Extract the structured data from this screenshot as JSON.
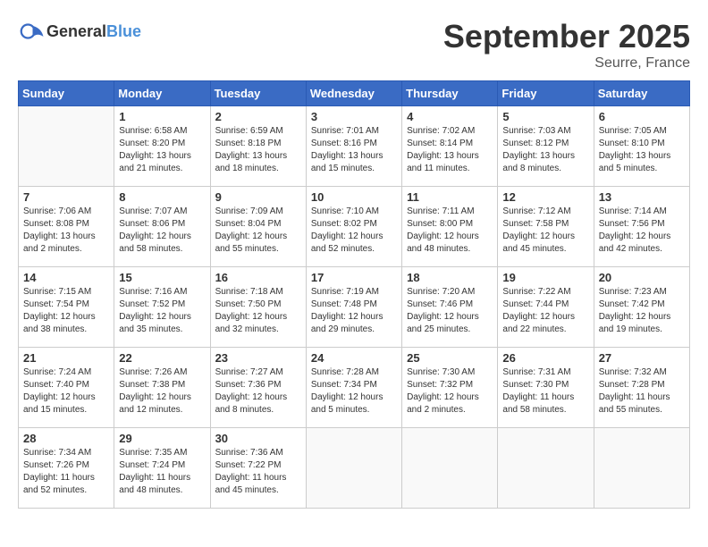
{
  "logo": {
    "general": "General",
    "blue": "Blue"
  },
  "title": "September 2025",
  "location": "Seurre, France",
  "weekdays": [
    "Sunday",
    "Monday",
    "Tuesday",
    "Wednesday",
    "Thursday",
    "Friday",
    "Saturday"
  ],
  "weeks": [
    [
      {
        "day": "",
        "info": ""
      },
      {
        "day": "1",
        "info": "Sunrise: 6:58 AM\nSunset: 8:20 PM\nDaylight: 13 hours\nand 21 minutes."
      },
      {
        "day": "2",
        "info": "Sunrise: 6:59 AM\nSunset: 8:18 PM\nDaylight: 13 hours\nand 18 minutes."
      },
      {
        "day": "3",
        "info": "Sunrise: 7:01 AM\nSunset: 8:16 PM\nDaylight: 13 hours\nand 15 minutes."
      },
      {
        "day": "4",
        "info": "Sunrise: 7:02 AM\nSunset: 8:14 PM\nDaylight: 13 hours\nand 11 minutes."
      },
      {
        "day": "5",
        "info": "Sunrise: 7:03 AM\nSunset: 8:12 PM\nDaylight: 13 hours\nand 8 minutes."
      },
      {
        "day": "6",
        "info": "Sunrise: 7:05 AM\nSunset: 8:10 PM\nDaylight: 13 hours\nand 5 minutes."
      }
    ],
    [
      {
        "day": "7",
        "info": "Sunrise: 7:06 AM\nSunset: 8:08 PM\nDaylight: 13 hours\nand 2 minutes."
      },
      {
        "day": "8",
        "info": "Sunrise: 7:07 AM\nSunset: 8:06 PM\nDaylight: 12 hours\nand 58 minutes."
      },
      {
        "day": "9",
        "info": "Sunrise: 7:09 AM\nSunset: 8:04 PM\nDaylight: 12 hours\nand 55 minutes."
      },
      {
        "day": "10",
        "info": "Sunrise: 7:10 AM\nSunset: 8:02 PM\nDaylight: 12 hours\nand 52 minutes."
      },
      {
        "day": "11",
        "info": "Sunrise: 7:11 AM\nSunset: 8:00 PM\nDaylight: 12 hours\nand 48 minutes."
      },
      {
        "day": "12",
        "info": "Sunrise: 7:12 AM\nSunset: 7:58 PM\nDaylight: 12 hours\nand 45 minutes."
      },
      {
        "day": "13",
        "info": "Sunrise: 7:14 AM\nSunset: 7:56 PM\nDaylight: 12 hours\nand 42 minutes."
      }
    ],
    [
      {
        "day": "14",
        "info": "Sunrise: 7:15 AM\nSunset: 7:54 PM\nDaylight: 12 hours\nand 38 minutes."
      },
      {
        "day": "15",
        "info": "Sunrise: 7:16 AM\nSunset: 7:52 PM\nDaylight: 12 hours\nand 35 minutes."
      },
      {
        "day": "16",
        "info": "Sunrise: 7:18 AM\nSunset: 7:50 PM\nDaylight: 12 hours\nand 32 minutes."
      },
      {
        "day": "17",
        "info": "Sunrise: 7:19 AM\nSunset: 7:48 PM\nDaylight: 12 hours\nand 29 minutes."
      },
      {
        "day": "18",
        "info": "Sunrise: 7:20 AM\nSunset: 7:46 PM\nDaylight: 12 hours\nand 25 minutes."
      },
      {
        "day": "19",
        "info": "Sunrise: 7:22 AM\nSunset: 7:44 PM\nDaylight: 12 hours\nand 22 minutes."
      },
      {
        "day": "20",
        "info": "Sunrise: 7:23 AM\nSunset: 7:42 PM\nDaylight: 12 hours\nand 19 minutes."
      }
    ],
    [
      {
        "day": "21",
        "info": "Sunrise: 7:24 AM\nSunset: 7:40 PM\nDaylight: 12 hours\nand 15 minutes."
      },
      {
        "day": "22",
        "info": "Sunrise: 7:26 AM\nSunset: 7:38 PM\nDaylight: 12 hours\nand 12 minutes."
      },
      {
        "day": "23",
        "info": "Sunrise: 7:27 AM\nSunset: 7:36 PM\nDaylight: 12 hours\nand 8 minutes."
      },
      {
        "day": "24",
        "info": "Sunrise: 7:28 AM\nSunset: 7:34 PM\nDaylight: 12 hours\nand 5 minutes."
      },
      {
        "day": "25",
        "info": "Sunrise: 7:30 AM\nSunset: 7:32 PM\nDaylight: 12 hours\nand 2 minutes."
      },
      {
        "day": "26",
        "info": "Sunrise: 7:31 AM\nSunset: 7:30 PM\nDaylight: 11 hours\nand 58 minutes."
      },
      {
        "day": "27",
        "info": "Sunrise: 7:32 AM\nSunset: 7:28 PM\nDaylight: 11 hours\nand 55 minutes."
      }
    ],
    [
      {
        "day": "28",
        "info": "Sunrise: 7:34 AM\nSunset: 7:26 PM\nDaylight: 11 hours\nand 52 minutes."
      },
      {
        "day": "29",
        "info": "Sunrise: 7:35 AM\nSunset: 7:24 PM\nDaylight: 11 hours\nand 48 minutes."
      },
      {
        "day": "30",
        "info": "Sunrise: 7:36 AM\nSunset: 7:22 PM\nDaylight: 11 hours\nand 45 minutes."
      },
      {
        "day": "",
        "info": ""
      },
      {
        "day": "",
        "info": ""
      },
      {
        "day": "",
        "info": ""
      },
      {
        "day": "",
        "info": ""
      }
    ]
  ]
}
